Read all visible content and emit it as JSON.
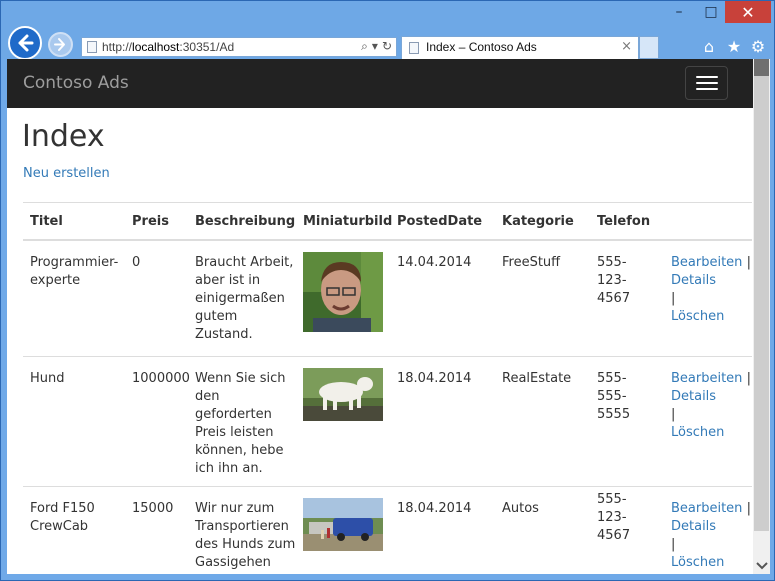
{
  "browser": {
    "url_prefix": "http://",
    "url_host": "localhost",
    "url_rest": ":30351/Ad",
    "tab_title": "Index – Contoso Ads",
    "tab_close": "×",
    "window_controls": {
      "minimize": "–",
      "maximize": "□",
      "close": "✕"
    },
    "address_icons": {
      "search": "⌕",
      "dropdown": "▾",
      "refresh": "↻"
    },
    "toolbar_icons": {
      "home": "⌂",
      "favorites": "★",
      "settings": "⚙"
    }
  },
  "navbar": {
    "brand": "Contoso Ads"
  },
  "page": {
    "title": "Index",
    "create_link": "Neu erstellen"
  },
  "table": {
    "headers": [
      "Titel",
      "Preis",
      "Beschreibung",
      "Miniaturbild",
      "PostedDate",
      "Kategorie",
      "Telefon",
      ""
    ],
    "rows": [
      {
        "title": "Programmier-experte",
        "price": "0",
        "description": "Braucht Arbeit, aber ist in einigermaßen gutem Zustand.",
        "date": "14.04.2014",
        "category": "FreeStuff",
        "phone": "555-123-4567",
        "edit": "Bearbeiten",
        "details": "Details",
        "delete": "Löschen",
        "sep": "|"
      },
      {
        "title": "Hund",
        "price": "1000000",
        "description": "Wenn Sie sich den geforderten Preis leisten können, hebe ich ihn an.",
        "date": "18.04.2014",
        "category": "RealEstate",
        "phone": "555-555-5555",
        "edit": "Bearbeiten",
        "details": "Details",
        "delete": "Löschen",
        "sep": "|"
      },
      {
        "title": "Ford F150 CrewCab",
        "price": "15000",
        "description": "Wir nur zum Transportieren des Hunds zum Gassigehen genutzt.",
        "date": "18.04.2014",
        "category": "Autos",
        "phone": "555-123-4567",
        "edit": "Bearbeiten",
        "details": "Details",
        "delete": "Löschen",
        "sep": "|"
      }
    ]
  },
  "colors": {
    "navbar": "#222222",
    "link": "#337ab7",
    "chrome": "#6ea8e6",
    "close": "#c8413a"
  }
}
